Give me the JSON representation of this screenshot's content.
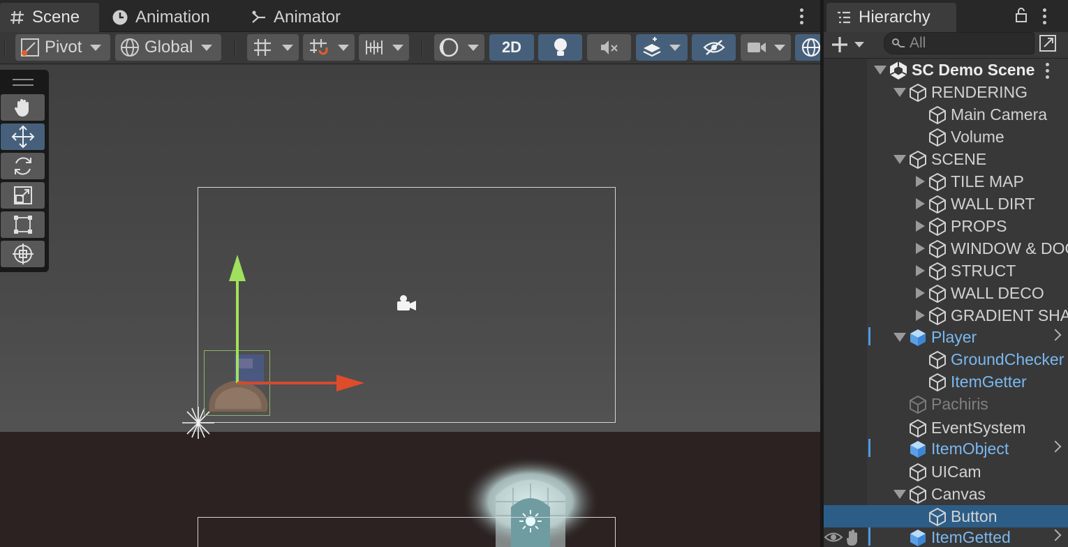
{
  "scene_window": {
    "tabs": [
      {
        "label": "Scene",
        "icon": "hash-icon"
      },
      {
        "label": "Animation",
        "icon": "clock-icon"
      },
      {
        "label": "Animator",
        "icon": "animator-icon"
      }
    ],
    "toolbar": {
      "pivot_label": "Pivot",
      "global_label": "Global",
      "mode_2d_label": "2D"
    }
  },
  "hierarchy": {
    "tab_label": "Hierarchy",
    "search_placeholder": "All",
    "rows": [
      {
        "name": "SC Demo Scene",
        "kind": "scene"
      },
      {
        "name": "RENDERING"
      },
      {
        "name": "Main Camera"
      },
      {
        "name": "Volume"
      },
      {
        "name": "SCENE"
      },
      {
        "name": "TILE MAP"
      },
      {
        "name": "WALL DIRT"
      },
      {
        "name": "PROPS"
      },
      {
        "name": "WINDOW & DOOR"
      },
      {
        "name": "STRUCT"
      },
      {
        "name": "WALL DECO"
      },
      {
        "name": "GRADIENT SHADOW"
      },
      {
        "name": "Player",
        "kind": "prefab"
      },
      {
        "name": "GroundChecker",
        "kind": "prefab-child"
      },
      {
        "name": "ItemGetter",
        "kind": "prefab-child"
      },
      {
        "name": "Pachiris",
        "kind": "inactive"
      },
      {
        "name": "EventSystem"
      },
      {
        "name": "ItemObject",
        "kind": "prefab"
      },
      {
        "name": "UICam"
      },
      {
        "name": "Canvas"
      },
      {
        "name": "Button",
        "selected": true
      },
      {
        "name": "ItemGetted",
        "kind": "prefab"
      }
    ]
  },
  "colors": {
    "selection": "#2c5d87",
    "prefab_text": "#7ab8f0",
    "active_button": "#46607c"
  }
}
